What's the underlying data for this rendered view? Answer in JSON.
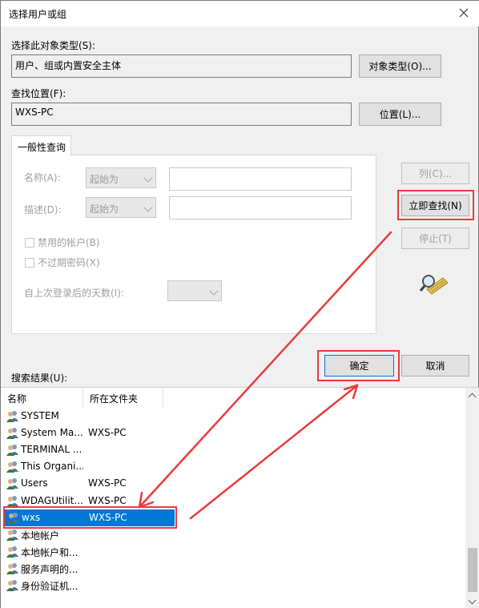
{
  "title": "选择用户或组",
  "object_type": {
    "label": "选择此对象类型(S):",
    "value": "用户、组或内置安全主体",
    "button": "对象类型(O)..."
  },
  "location": {
    "label": "查找位置(F):",
    "value": "WXS-PC",
    "button": "位置(L)..."
  },
  "query_tab": "一般性查询",
  "query": {
    "name_label": "名称(A):",
    "name_mode": "起始为",
    "desc_label": "描述(D):",
    "desc_mode": "起始为",
    "disabled_accounts": "禁用的帐户(B)",
    "non_expiring_pw": "不过期密码(X)",
    "days_label": "自上次登录后的天数(I):"
  },
  "buttons": {
    "columns": "列(C)...",
    "find_now": "立即查找(N)",
    "stop": "停止(T)",
    "ok": "确定",
    "cancel": "取消"
  },
  "results_label": "搜索结果(U):",
  "results": {
    "headers": [
      "名称",
      "所在文件夹"
    ],
    "rows": [
      {
        "name": "SYSTEM",
        "folder": ""
      },
      {
        "name": "System Ma...",
        "folder": "WXS-PC"
      },
      {
        "name": "TERMINAL ...",
        "folder": ""
      },
      {
        "name": "This Organi...",
        "folder": ""
      },
      {
        "name": "Users",
        "folder": "WXS-PC"
      },
      {
        "name": "WDAGUtilit...",
        "folder": "WXS-PC"
      },
      {
        "name": "wxs",
        "folder": "WXS-PC",
        "selected": true
      },
      {
        "name": "本地帐户",
        "folder": ""
      },
      {
        "name": "本地帐户和...",
        "folder": ""
      },
      {
        "name": "服务声明的...",
        "folder": ""
      },
      {
        "name": "身份验证机...",
        "folder": ""
      }
    ]
  },
  "colors": {
    "selection": "#0078d7",
    "annotation_red": "#e83b3b"
  }
}
